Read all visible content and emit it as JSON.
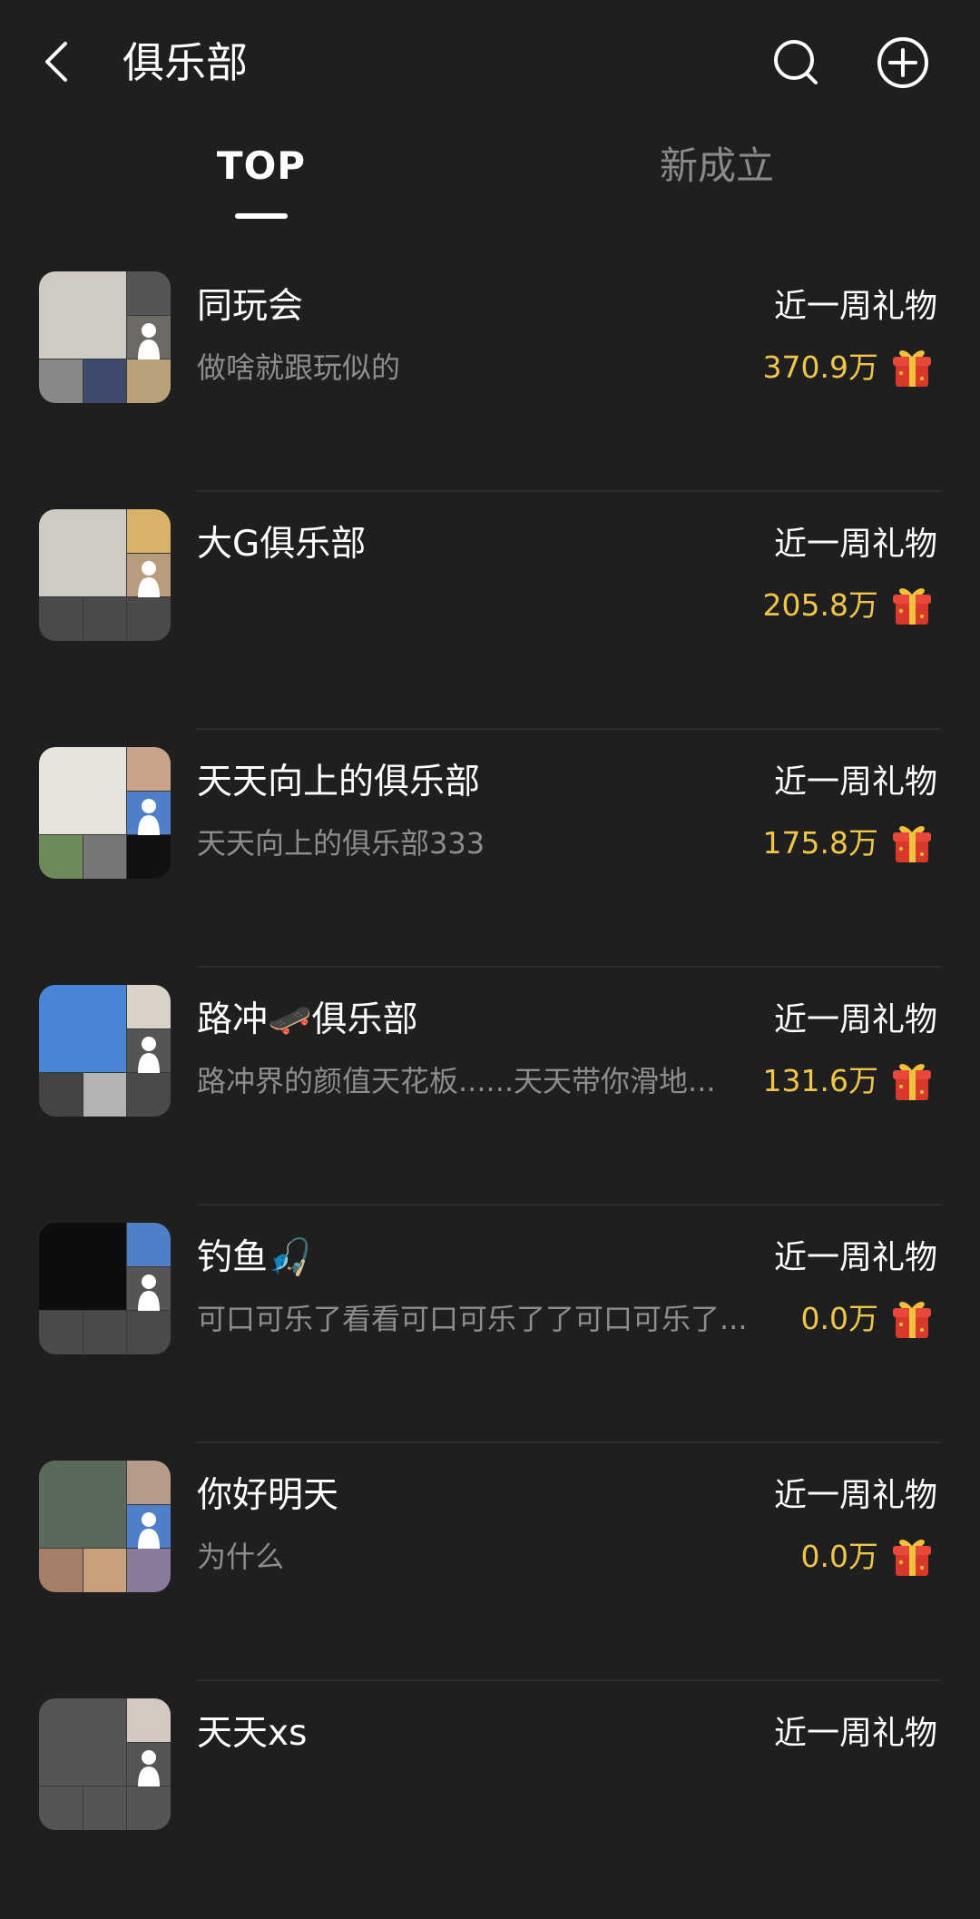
{
  "header": {
    "title": "俱乐部",
    "back_icon": "chevron-left-icon",
    "search_icon": "search-icon",
    "add_icon": "plus-circle-icon"
  },
  "tabs": [
    {
      "label": "TOP",
      "active": true
    },
    {
      "label": "新成立",
      "active": false
    }
  ],
  "colors": {
    "background": "#1f1f1f",
    "gift_value": "#f0c64a",
    "secondary_text": "#8d8d8d",
    "gift_red": "#d9392b",
    "gift_gold": "#f3c23c"
  },
  "clubs": [
    {
      "name": "同玩会",
      "desc": "做啥就跟玩似的",
      "gift_label": "近一周礼物",
      "gift_value": "370.9万"
    },
    {
      "name": "大G俱乐部",
      "desc": "",
      "gift_label": "近一周礼物",
      "gift_value": "205.8万"
    },
    {
      "name": "天天向上的俱乐部",
      "desc": "天天向上的俱乐部333",
      "gift_label": "近一周礼物",
      "gift_value": "175.8万"
    },
    {
      "name": "路冲🛹俱乐部",
      "desc": "路冲界的颜值天花板......天天带你滑地...",
      "gift_label": "近一周礼物",
      "gift_value": "131.6万"
    },
    {
      "name": "钓鱼🎣",
      "desc": "可口可乐了看看可口可乐了了可口可乐了...",
      "gift_label": "近一周礼物",
      "gift_value": "0.0万"
    },
    {
      "name": "你好明天",
      "desc": "为什么",
      "gift_label": "近一周礼物",
      "gift_value": "0.0万"
    },
    {
      "name": "天天xs",
      "desc": "",
      "gift_label": "近一周礼物",
      "gift_value": ""
    }
  ]
}
